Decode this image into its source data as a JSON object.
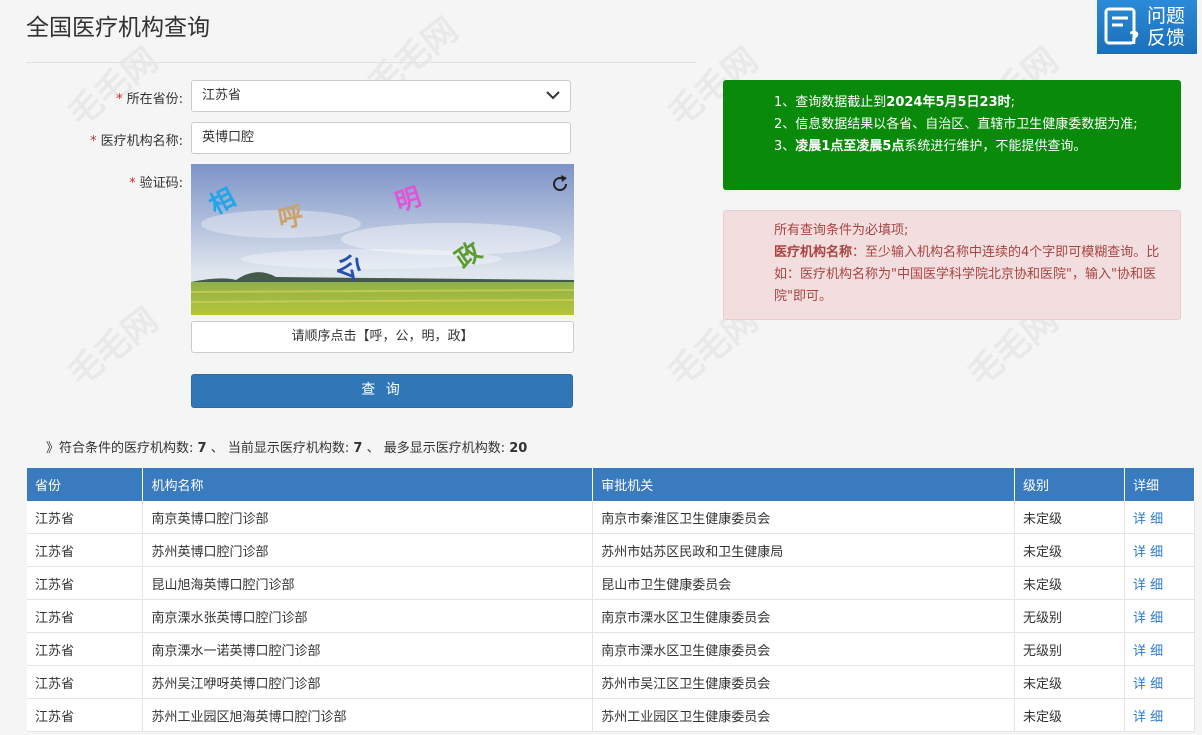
{
  "page": {
    "title": "全国医疗机构查询"
  },
  "feedback": {
    "label_line1": "问题",
    "label_line2": "反馈",
    "icon": "feedback-doc-icon"
  },
  "form": {
    "province_label": "所在省份:",
    "province_value": "江苏省",
    "name_label": "医疗机构名称:",
    "name_value": "英博口腔",
    "captcha_label": "验证码:",
    "captcha_chars": [
      "相",
      "呼",
      "明",
      "公",
      "政"
    ],
    "captcha_hint": "请顺序点击【呼，公，明，政】",
    "submit_label": "查 询"
  },
  "notice_green": {
    "line1_a": "1、查询数据截止到",
    "line1_b": "2024年5月5日23时",
    "line1_c": ";",
    "line2": "2、信息数据结果以各省、自治区、直辖市卫生健康委数据为准;",
    "line3_a": "3、",
    "line3_b": "凌晨1点至凌晨5点",
    "line3_c": "系统进行维护，不能提供查询。"
  },
  "notice_red": {
    "line1": "所有查询条件为必填项;",
    "line2_bold": "医疗机构名称",
    "line2_rest": "：至少输入机构名称中连续的4个字即可模糊查询。比如：医疗机构名称为\"中国医学科学院北京协和医院\"，输入\"协和医院\"即可。"
  },
  "stats": {
    "prefix": "》符合条件的医疗机构数:",
    "match": "7",
    "sep1": "、 当前显示医疗机构数:",
    "shown": "7",
    "sep2": "、 最多显示医疗机构数:",
    "max": "20"
  },
  "table": {
    "headers": [
      "省份",
      "机构名称",
      "审批机关",
      "级别",
      "详细"
    ],
    "rows": [
      [
        "江苏省",
        "南京英博口腔门诊部",
        "南京市秦淮区卫生健康委员会",
        "未定级",
        "详 细"
      ],
      [
        "江苏省",
        "苏州英博口腔门诊部",
        "苏州市姑苏区民政和卫生健康局",
        "未定级",
        "详 细"
      ],
      [
        "江苏省",
        "昆山旭海英博口腔门诊部",
        "昆山市卫生健康委员会",
        "未定级",
        "详 细"
      ],
      [
        "江苏省",
        "南京溧水张英博口腔门诊部",
        "南京市溧水区卫生健康委员会",
        "无级别",
        "详 细"
      ],
      [
        "江苏省",
        "南京溧水一诺英博口腔门诊部",
        "南京市溧水区卫生健康委员会",
        "无级别",
        "详 细"
      ],
      [
        "江苏省",
        "苏州吴江咿呀英博口腔门诊部",
        "苏州市吴江区卫生健康委员会",
        "未定级",
        "详 细"
      ],
      [
        "江苏省",
        "苏州工业园区旭海英博口腔门诊部",
        "苏州工业园区卫生健康委员会",
        "未定级",
        "详 细"
      ]
    ]
  },
  "watermark_text": "毛毛网"
}
